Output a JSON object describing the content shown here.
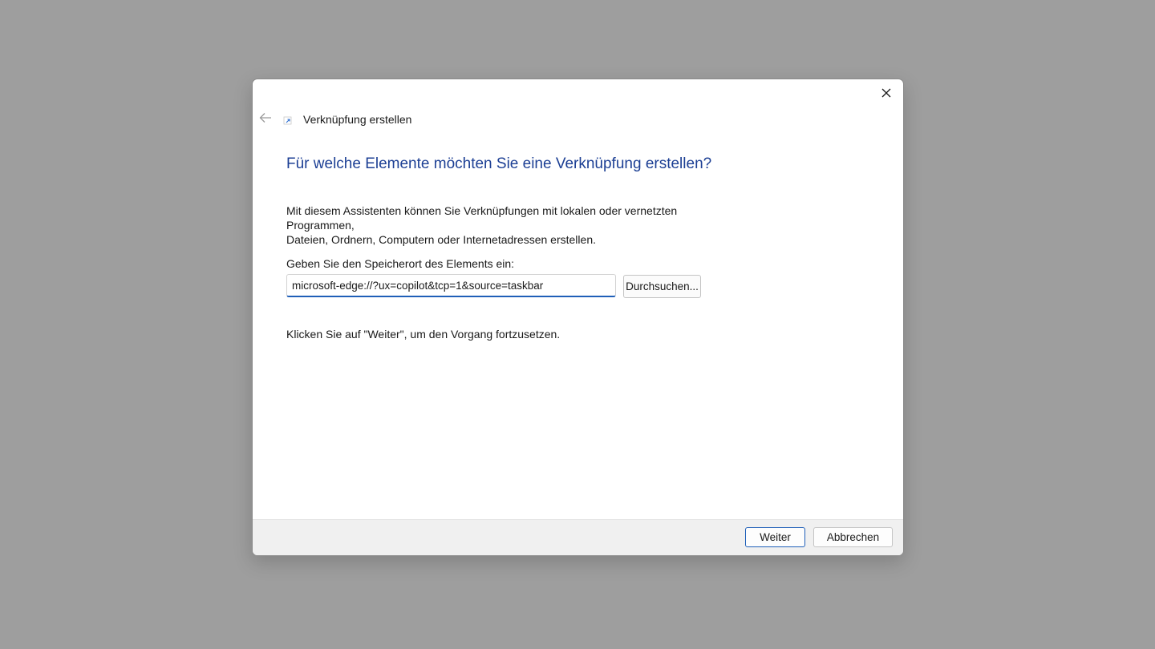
{
  "icons": {
    "close": "close-icon",
    "back": "back-arrow-icon",
    "shortcut": "shortcut-icon"
  },
  "colors": {
    "heading": "#1c3f94",
    "accent": "#1f5fb8",
    "backdrop": "#9e9e9e"
  },
  "wizard": {
    "title": "Verknüpfung erstellen",
    "heading": "Für welche Elemente möchten Sie eine Verknüpfung erstellen?",
    "description_line1": "Mit diesem Assistenten können Sie Verknüpfungen mit lokalen oder vernetzten Programmen,",
    "description_line2": "Dateien, Ordnern, Computern oder Internetadressen erstellen.",
    "location_label": "Geben Sie den Speicherort des Elements ein:",
    "location_value": "microsoft-edge://?ux=copilot&tcp=1&source=taskbar",
    "browse_label": "Durchsuchen...",
    "hint": "Klicken Sie auf \"Weiter\", um den Vorgang fortzusetzen."
  },
  "footer": {
    "next_label": "Weiter",
    "cancel_label": "Abbrechen"
  }
}
